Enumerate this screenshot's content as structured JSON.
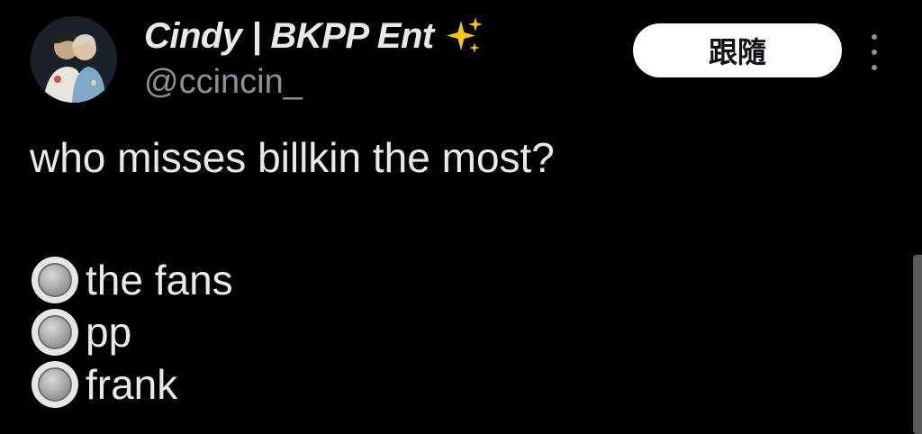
{
  "tweet": {
    "author": {
      "display_name": "Cindy | BKPP Ent",
      "badge_icon": "sparkles-icon",
      "handle": "@ccincin_",
      "avatar_icon": "avatar-photo"
    },
    "follow_label": "跟隨",
    "more_icon": "more-vertical-icon",
    "text": "who misses billkin the most?",
    "poll_options": [
      {
        "label": "the fans",
        "icon": "radio-button-icon"
      },
      {
        "label": "pp",
        "icon": "radio-button-icon"
      },
      {
        "label": "frank",
        "icon": "radio-button-icon"
      }
    ]
  },
  "theme": {
    "background": "#000000",
    "text": "#e7e9ea",
    "secondary_text": "#8b9098",
    "follow_button_bg": "#ffffff",
    "follow_button_text": "#0f1419",
    "sparkle_color": "#f5c518"
  }
}
